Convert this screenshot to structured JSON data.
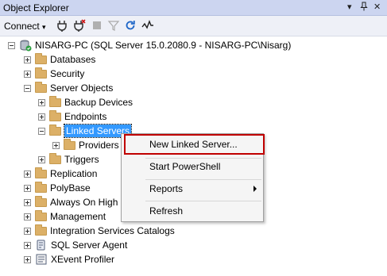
{
  "panel": {
    "title": "Object Explorer",
    "pin_icon": "pin-icon",
    "dropdown_icon": "dropdown-icon",
    "close_icon": "close-icon"
  },
  "toolbar": {
    "connect_label": "Connect",
    "icons": [
      "connect-object-explorer-icon",
      "disconnect-icon",
      "stop-icon",
      "filter-icon",
      "refresh-icon",
      "activity-monitor-icon"
    ]
  },
  "tree": {
    "server": "NISARG-PC (SQL Server 15.0.2080.9 - NISARG-PC\\Nisarg)",
    "databases": "Databases",
    "security": "Security",
    "server_objects": "Server Objects",
    "backup_devices": "Backup Devices",
    "endpoints": "Endpoints",
    "linked_servers": "Linked Servers",
    "providers": "Providers",
    "triggers": "Triggers",
    "replication": "Replication",
    "polybase": "PolyBase",
    "always_on": "Always On High",
    "management": "Management",
    "integration_services": "Integration Services Catalogs",
    "sql_server_agent": "SQL Server Agent",
    "xevent_profiler": "XEvent Profiler"
  },
  "context_menu": {
    "new_linked_server": "New Linked Server...",
    "start_powershell": "Start PowerShell",
    "reports": "Reports",
    "refresh": "Refresh"
  },
  "colors": {
    "highlight_border": "#c00000",
    "selection": "#3399ff",
    "folder": "#dcb067"
  }
}
